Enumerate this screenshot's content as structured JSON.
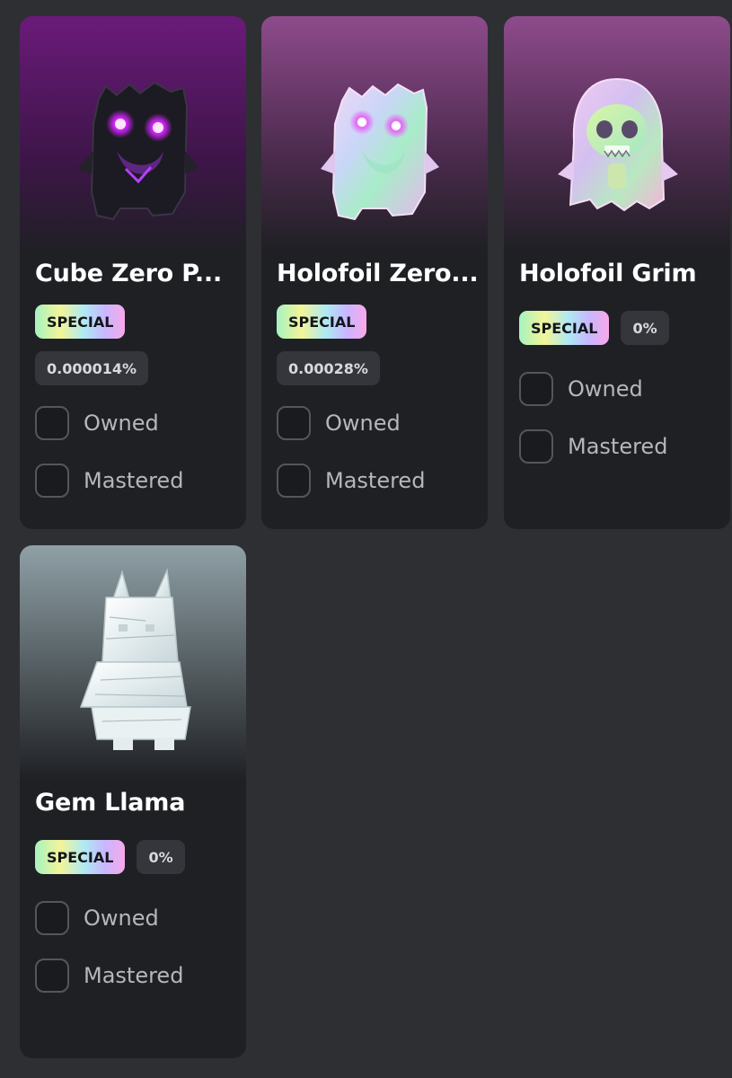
{
  "cards": [
    {
      "title": "Cube Zero P...",
      "badge": "SPECIAL",
      "rarity": "0.000014%",
      "owned_label": "Owned",
      "mastered_label": "Mastered",
      "image_icon": "cube-zero-figure-icon",
      "bg_top": "#6b1a7a"
    },
    {
      "title": "Holofoil Zero...",
      "badge": "SPECIAL",
      "rarity": "0.00028%",
      "owned_label": "Owned",
      "mastered_label": "Mastered",
      "image_icon": "holofoil-zero-figure-icon",
      "bg_top": "#8e4b8c"
    },
    {
      "title": "Holofoil Grim",
      "badge": "SPECIAL",
      "rarity": "0%",
      "owned_label": "Owned",
      "mastered_label": "Mastered",
      "image_icon": "holofoil-grim-figure-icon",
      "bg_top": "#8e4b8c"
    },
    {
      "title": "Gem Llama",
      "badge": "SPECIAL",
      "rarity": "0%",
      "owned_label": "Owned",
      "mastered_label": "Mastered",
      "image_icon": "gem-llama-figure-icon",
      "bg_top": "#8fa0a6"
    }
  ],
  "colors": {
    "page_bg": "#2e2f33",
    "card_bg": "#1f2024",
    "title_text": "#ffffff",
    "muted_text": "#b6b7bd"
  }
}
